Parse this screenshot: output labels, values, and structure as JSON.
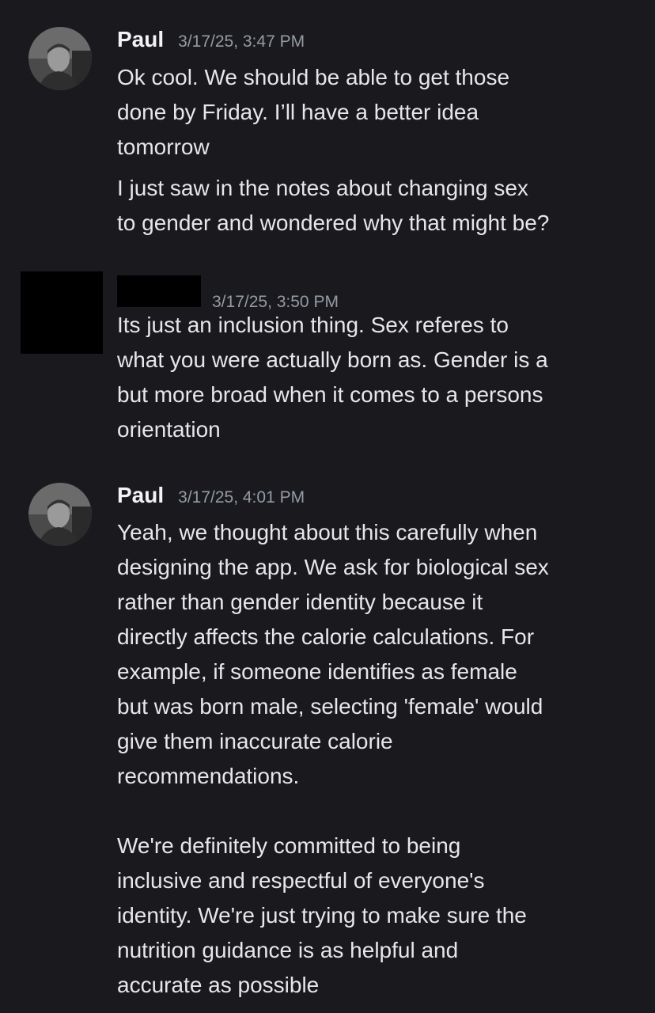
{
  "messages": [
    {
      "author": "Paul",
      "timestamp": "3/17/25, 3:47 PM",
      "paragraphs": [
        "Ok cool. We should be able to get those\ndone by Friday. I’ll have a better idea\ntomorrow",
        "I just saw in the notes about changing sex\nto gender and wondered why that might be?"
      ]
    },
    {
      "author": "",
      "timestamp": "3/17/25, 3:50 PM",
      "paragraphs": [
        "Its just an inclusion thing. Sex referes to\nwhat you were actually born as. Gender is a\nbut more broad when it comes to a persons\norientation"
      ]
    },
    {
      "author": "Paul",
      "timestamp": "3/17/25, 4:01 PM",
      "paragraphs": [
        "Yeah, we thought about this carefully when\ndesigning the app. We ask for biological sex\nrather than gender identity because it\ndirectly affects the calorie calculations. For\nexample, if someone identifies as female\nbut was born male, selecting 'female' would\ngive them inaccurate calorie\nrecommendations.\n\nWe're definitely committed to being\ninclusive and respectful of everyone's\nidentity. We're just trying to make sure the\nnutrition guidance is as helpful and\naccurate as possible"
      ]
    }
  ]
}
